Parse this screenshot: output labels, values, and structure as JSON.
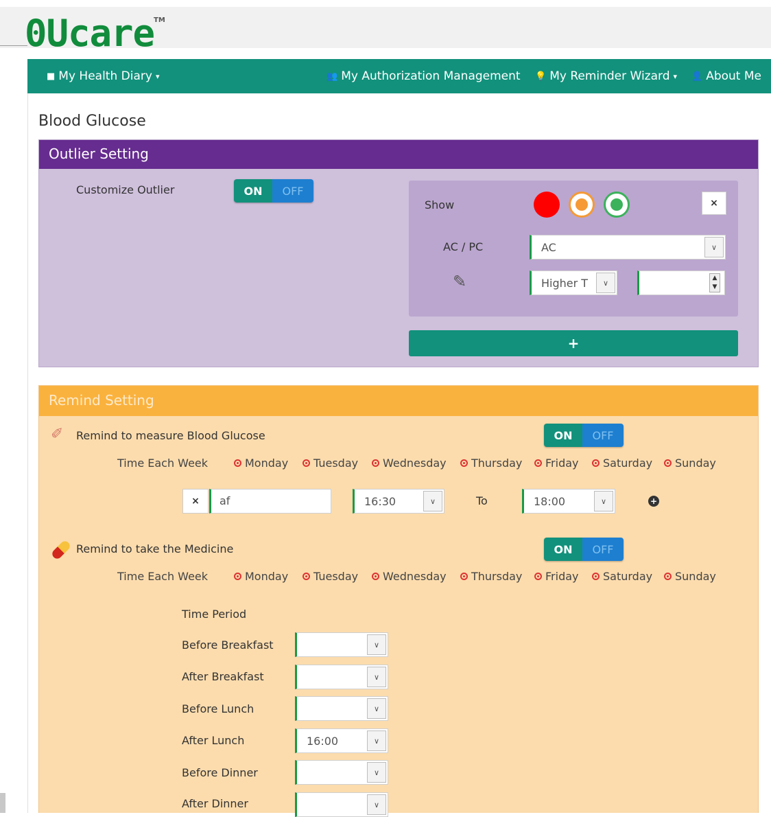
{
  "brand": {
    "logo": "0Ucare",
    "tm": "TM"
  },
  "nav": {
    "health_diary": "My Health Diary",
    "authorization": "My Authorization Management",
    "reminder": "My Reminder Wizard",
    "about": "About Me",
    "dropdown_marker": "▾"
  },
  "page": {
    "title": "Blood Glucose"
  },
  "outlier": {
    "header": "Outlier Setting",
    "customize_label": "Customize Outlier",
    "toggle_on": "ON",
    "toggle_off": "OFF",
    "show_label": "Show",
    "acpc_label": "AC / PC",
    "acpc_value": "AC",
    "compare_value": "Higher T",
    "number_value": "",
    "remove_label": "×",
    "add_label": "+",
    "colors": {
      "red": "#ff0000",
      "orange": "#f59a34",
      "green": "#3bb25b"
    }
  },
  "remind": {
    "header": "Remind Setting",
    "glucose": {
      "label": "Remind to measure Blood Glucose",
      "toggle_on": "ON",
      "toggle_off": "OFF",
      "time_each_week": "Time Each Week",
      "days": [
        "Monday",
        "Tuesday",
        "Wednesday",
        "Thursday",
        "Friday",
        "Saturday",
        "Sunday"
      ],
      "note_value": "af",
      "from_time": "16:30",
      "to_label": "To",
      "to_time": "18:00",
      "remove_label": "×",
      "add_label": "+"
    },
    "medicine": {
      "label": "Remind to take the Medicine",
      "toggle_on": "ON",
      "toggle_off": "OFF",
      "time_each_week": "Time Each Week",
      "days": [
        "Monday",
        "Tuesday",
        "Wednesday",
        "Thursday",
        "Friday",
        "Saturday",
        "Sunday"
      ],
      "time_period_label": "Time Period",
      "periods": [
        {
          "label": "Before Breakfast",
          "value": ""
        },
        {
          "label": "After Breakfast",
          "value": ""
        },
        {
          "label": "Before Lunch",
          "value": ""
        },
        {
          "label": "After Lunch",
          "value": "16:00"
        },
        {
          "label": "Before Dinner",
          "value": ""
        },
        {
          "label": "After Dinner",
          "value": ""
        }
      ]
    }
  },
  "colors": {
    "nav": "#12917c",
    "outlier_head": "#662c8f",
    "remind_head": "#fab23e",
    "logo": "#118c3c"
  }
}
